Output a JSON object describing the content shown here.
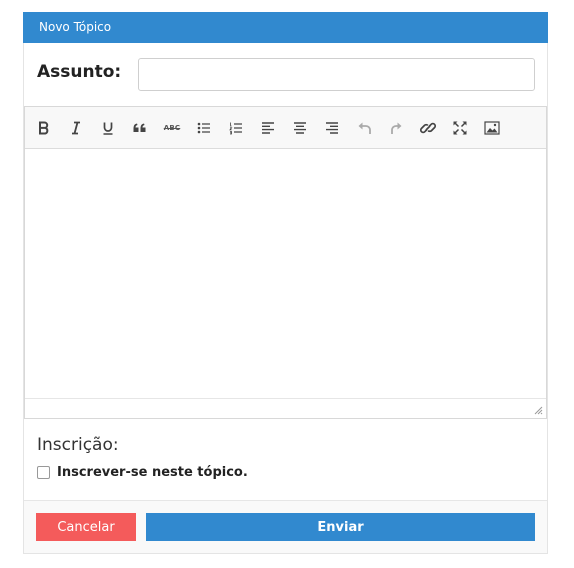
{
  "header": {
    "title": "Novo Tópico"
  },
  "subject": {
    "label": "Assunto:",
    "value": "",
    "placeholder": ""
  },
  "toolbar": {
    "buttons": [
      {
        "name": "bold",
        "icon": "bold-icon"
      },
      {
        "name": "italic",
        "icon": "italic-icon"
      },
      {
        "name": "underline",
        "icon": "underline-icon"
      },
      {
        "name": "blockquote",
        "icon": "quote-icon"
      },
      {
        "name": "strikethrough",
        "icon": "strikethrough-icon"
      },
      {
        "name": "bullet-list",
        "icon": "bullet-list-icon"
      },
      {
        "name": "numbered-list",
        "icon": "numbered-list-icon"
      },
      {
        "name": "align-left",
        "icon": "align-left-icon"
      },
      {
        "name": "align-center",
        "icon": "align-center-icon"
      },
      {
        "name": "align-right",
        "icon": "align-right-icon"
      },
      {
        "name": "undo",
        "icon": "undo-icon"
      },
      {
        "name": "redo",
        "icon": "redo-icon"
      },
      {
        "name": "link",
        "icon": "link-icon"
      },
      {
        "name": "fullscreen",
        "icon": "fullscreen-icon"
      },
      {
        "name": "image",
        "icon": "image-icon"
      }
    ],
    "strike_text": "ABC"
  },
  "subscription": {
    "heading": "Inscrição:",
    "checkbox_label": "Inscrever-se neste tópico.",
    "checked": false
  },
  "actions": {
    "cancel_label": "Cancelar",
    "submit_label": "Enviar"
  },
  "colors": {
    "header": "#3189cf",
    "submit": "#3189cf",
    "cancel": "#f45b5b"
  }
}
